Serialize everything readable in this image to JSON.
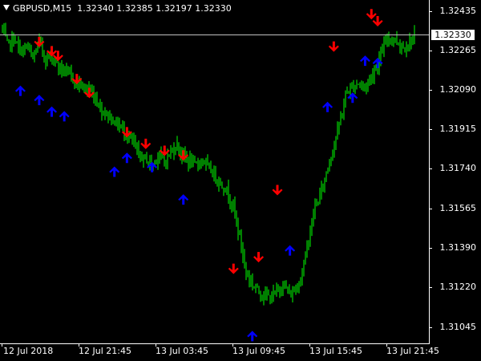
{
  "header": {
    "symbol": "GBPUSD,M15",
    "open": "1.32340",
    "high": "1.32385",
    "low": "1.32197",
    "close": "1.32330"
  },
  "price_axis": {
    "labels": [
      "1.32435",
      "1.32265",
      "1.32090",
      "1.31915",
      "1.31740",
      "1.31565",
      "1.31390",
      "1.31220",
      "1.31045"
    ],
    "current_price": "1.32330"
  },
  "time_axis": {
    "labels": [
      "12 Jul 2018",
      "12 Jul 21:45",
      "13 Jul 03:45",
      "13 Jul 09:45",
      "13 Jul 15:45",
      "13 Jul 21:45"
    ]
  },
  "colors": {
    "background": "#000000",
    "candle": "#00ff00",
    "sell_arrow": "#ff0000",
    "buy_arrow": "#0000ff",
    "axis": "#ffffff",
    "current_price_line": "#c0c0c0"
  },
  "chart_data": {
    "type": "candlestick",
    "series_path": [
      1.3236,
      1.3228,
      1.3231,
      1.3225,
      1.3228,
      1.3222,
      1.323,
      1.3222,
      1.3224,
      1.3219,
      1.3217,
      1.3215,
      1.3212,
      1.321,
      1.3209,
      1.3205,
      1.32,
      1.3198,
      1.3195,
      1.3193,
      1.3189,
      1.3186,
      1.318,
      1.3179,
      1.3176,
      1.3181,
      1.3178,
      1.3182,
      1.3185,
      1.318,
      1.3178,
      1.3176,
      1.3179,
      1.3175,
      1.3172,
      1.3168,
      1.3165,
      1.3158,
      1.3145,
      1.313,
      1.3125,
      1.3122,
      1.312,
      1.3119,
      1.3122,
      1.3125,
      1.312,
      1.3123,
      1.313,
      1.3145,
      1.3158,
      1.3165,
      1.3175,
      1.3185,
      1.3195,
      1.3208,
      1.321,
      1.3212,
      1.321,
      1.3215,
      1.322,
      1.3228,
      1.3232,
      1.323,
      1.3227,
      1.3229,
      1.3233
    ],
    "sell_signals": [
      {
        "bar": 6,
        "price": 1.3229
      },
      {
        "bar": 8,
        "price": 1.3225
      },
      {
        "bar": 9,
        "price": 1.3223
      },
      {
        "bar": 12,
        "price": 1.3213
      },
      {
        "bar": 14,
        "price": 1.3207
      },
      {
        "bar": 20,
        "price": 1.319
      },
      {
        "bar": 23,
        "price": 1.3185
      },
      {
        "bar": 26,
        "price": 1.3182
      },
      {
        "bar": 29,
        "price": 1.318
      },
      {
        "bar": 37,
        "price": 1.3131
      },
      {
        "bar": 41,
        "price": 1.3136
      },
      {
        "bar": 44,
        "price": 1.3165
      },
      {
        "bar": 53,
        "price": 1.3227
      },
      {
        "bar": 59,
        "price": 1.3241
      },
      {
        "bar": 60,
        "price": 1.3238
      }
    ],
    "buy_signals": [
      {
        "bar": 3,
        "price": 1.3209
      },
      {
        "bar": 6,
        "price": 1.3205
      },
      {
        "bar": 8,
        "price": 1.32
      },
      {
        "bar": 10,
        "price": 1.3198
      },
      {
        "bar": 18,
        "price": 1.3174
      },
      {
        "bar": 20,
        "price": 1.318
      },
      {
        "bar": 24,
        "price": 1.3176
      },
      {
        "bar": 29,
        "price": 1.3162
      },
      {
        "bar": 40,
        "price": 1.3103
      },
      {
        "bar": 46,
        "price": 1.314
      },
      {
        "bar": 52,
        "price": 1.3202
      },
      {
        "bar": 56,
        "price": 1.3206
      },
      {
        "bar": 58,
        "price": 1.3222
      },
      {
        "bar": 60,
        "price": 1.3221
      }
    ],
    "ylim": [
      1.31,
      1.3247
    ],
    "grid": false
  }
}
